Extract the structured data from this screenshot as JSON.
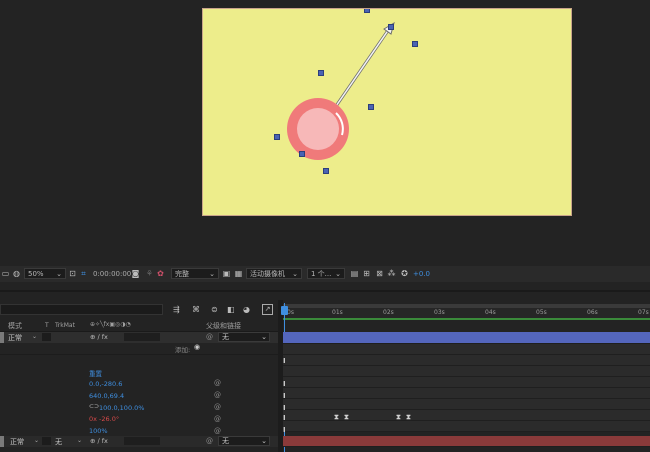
{
  "viewer_toolbar": {
    "zoom": "50%",
    "timecode": "0:00:00:00",
    "resolution": "完整",
    "camera": "活动摄像机",
    "views": "1 个...",
    "exposure": "+0.0"
  },
  "layer_panel": {
    "col_mode": "模式",
    "col_t": "T",
    "col_trkmat": "TrkMat",
    "col_parent": "父级和链接",
    "layer1": {
      "mode": "正常",
      "parent": "无"
    },
    "add_label": "添加:",
    "props": {
      "reset": "重置",
      "anchor": "0.0,-280.6",
      "position": "640.0,69.4",
      "scale": "100.0,100.0%",
      "rotation": "0x -26.0°",
      "opacity": "100%"
    },
    "layer2": {
      "mode": "正常",
      "trkmat": "无",
      "parent": "无"
    }
  },
  "ruler": {
    "ticks": [
      "0s",
      "01s",
      "02s",
      "03s",
      "04s",
      "05s",
      "06s",
      "07s"
    ]
  },
  "icons": [
    "monitor-icon",
    "camera-icon",
    "color-icon",
    "grid-icon",
    "lock-icon"
  ],
  "colors": {
    "comp_bg": "#eded8b",
    "ball_outer": "#f07a7a",
    "ball_inner": "#f7b8b8",
    "layer_bar_blue": "#5466bd",
    "layer_bar_red": "#8a3a3a",
    "accent_blue": "#3f8fe0"
  }
}
